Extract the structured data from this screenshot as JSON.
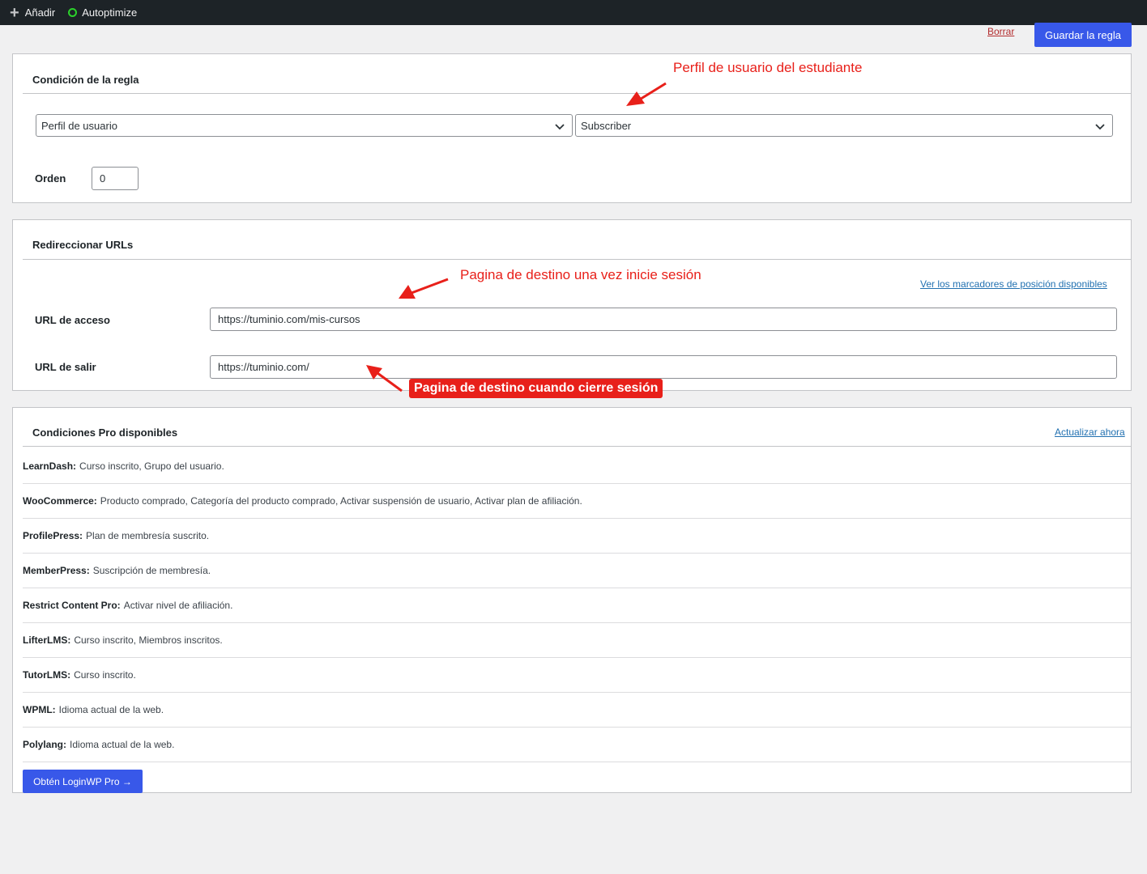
{
  "adminbar": {
    "add_label": "Añadir",
    "plugin_label": "Autoptimize"
  },
  "actions": {
    "delete_label": "Borrar",
    "save_label": "Guardar la regla"
  },
  "condition": {
    "title": "Condición de la regla",
    "field_select": "Perfil de usuario",
    "value_select": "Subscriber",
    "order_label": "Orden",
    "order_value": "0",
    "annotation": "Perfil de usuario del estudiante"
  },
  "redirect": {
    "title": "Redireccionar URLs",
    "placeholders_link": "Ver los marcadores de posición disponibles",
    "login_label": "URL de acceso",
    "login_value": "https://tuminio.com/mis-cursos",
    "logout_label": "URL de salir",
    "logout_value": "https://tuminio.com/",
    "login_annotation": "Pagina de destino una vez inicie sesión",
    "logout_annotation": "Pagina de destino cuando cierre sesión"
  },
  "pro": {
    "title": "Condiciones Pro disponibles",
    "upgrade_link": "Actualizar ahora",
    "items": [
      {
        "name": "LearnDash:",
        "desc": "Curso inscrito, Grupo del usuario."
      },
      {
        "name": "WooCommerce:",
        "desc": "Producto comprado, Categoría del producto comprado, Activar suspensión de usuario, Activar plan de afiliación."
      },
      {
        "name": "ProfilePress:",
        "desc": "Plan de membresía suscrito."
      },
      {
        "name": "MemberPress:",
        "desc": "Suscripción de membresía."
      },
      {
        "name": "Restrict Content Pro:",
        "desc": "Activar nivel de afiliación."
      },
      {
        "name": "LifterLMS:",
        "desc": "Curso inscrito, Miembros inscritos."
      },
      {
        "name": "TutorLMS:",
        "desc": "Curso inscrito."
      },
      {
        "name": "WPML:",
        "desc": "Idioma actual de la web."
      },
      {
        "name": "Polylang:",
        "desc": "Idioma actual de la web."
      }
    ],
    "cta_label": "Obtén LoginWP Pro →"
  },
  "colors": {
    "primary": "#3858e9",
    "annotation": "#e8201a",
    "adminbar": "#1d2327"
  }
}
